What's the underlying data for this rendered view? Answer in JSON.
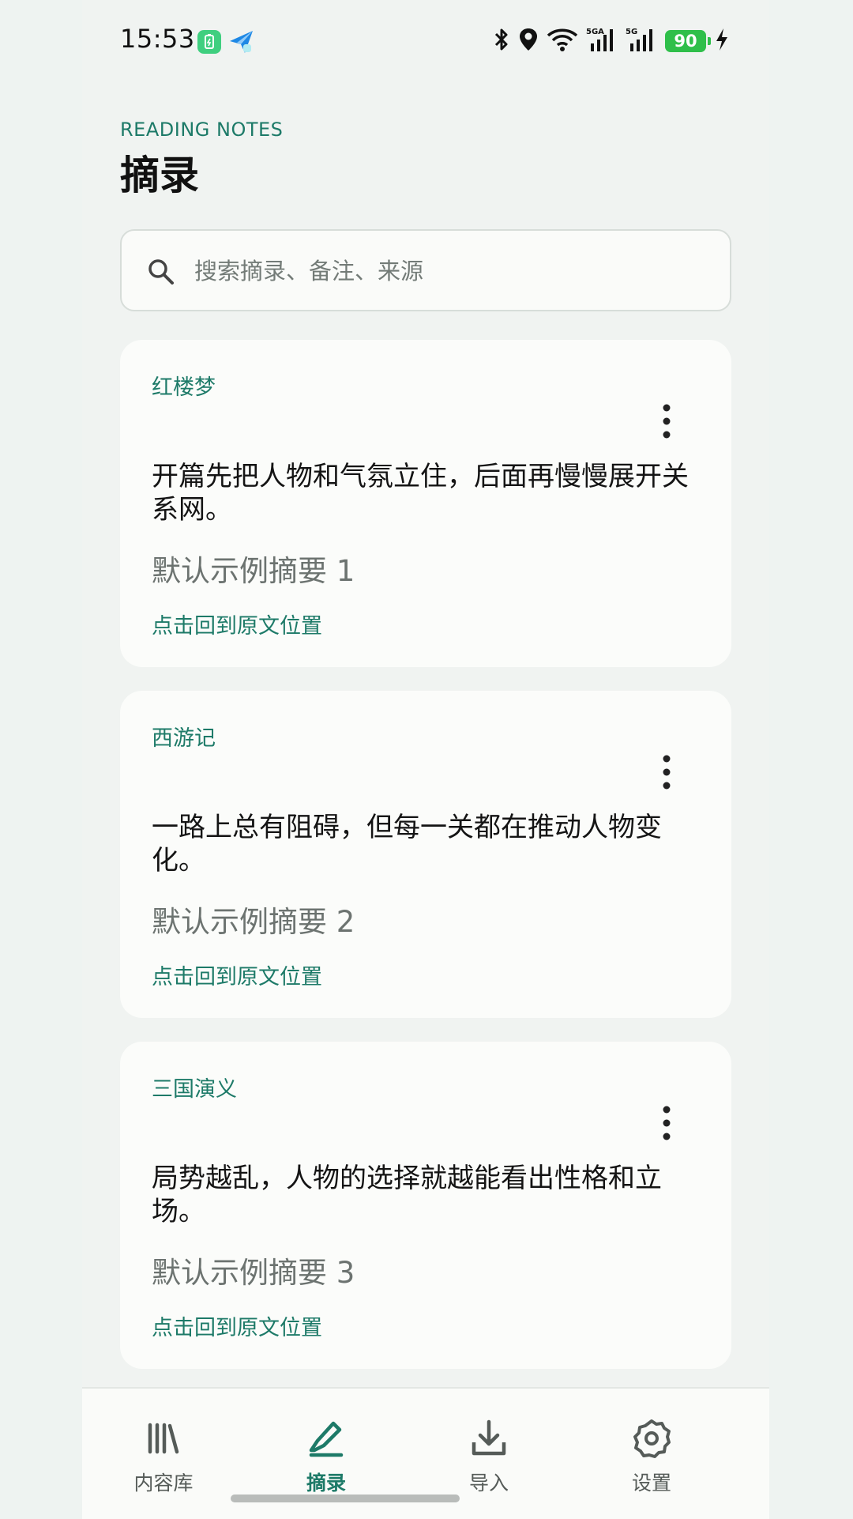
{
  "status_bar": {
    "time": "15:53",
    "network_1": "5GA",
    "network_2": "5G",
    "battery": "90"
  },
  "header": {
    "overline": "READING NOTES",
    "title": "摘录"
  },
  "search": {
    "placeholder": "搜索摘录、备注、来源"
  },
  "cards": [
    {
      "source": "红楼梦",
      "quote": "开篇先把人物和气氛立住，后面再慢慢展开关系网。",
      "note": "默认示例摘要 1",
      "link": "点击回到原文位置"
    },
    {
      "source": "西游记",
      "quote": "一路上总有阻碍，但每一关都在推动人物变化。",
      "note": "默认示例摘要 2",
      "link": "点击回到原文位置"
    },
    {
      "source": "三国演义",
      "quote": "局势越乱，人物的选择就越能看出性格和立场。",
      "note": "默认示例摘要 3",
      "link": "点击回到原文位置"
    }
  ],
  "bottom_nav": {
    "items": [
      {
        "label": "内容库",
        "icon": "library-icon"
      },
      {
        "label": "摘录",
        "icon": "highlight-pen-icon",
        "active": true
      },
      {
        "label": "导入",
        "icon": "download-icon"
      },
      {
        "label": "设置",
        "icon": "gear-icon"
      }
    ]
  },
  "colors": {
    "accent": "#1d7a68",
    "background": "#f0f3f1",
    "card": "#fbfcfa"
  }
}
